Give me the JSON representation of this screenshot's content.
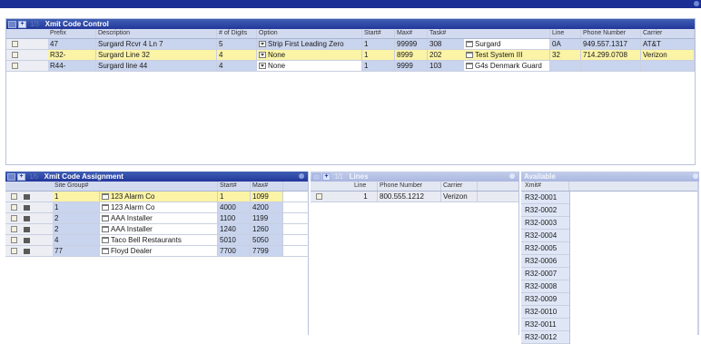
{
  "top_bar": {
    "color": "#1d2f95"
  },
  "xmit_code_control": {
    "title": "Xmit Code Control",
    "tb_labels": "1/3",
    "columns": [
      "Prefix",
      "Description",
      "# of Digits",
      "Option",
      "Start#",
      "Max#",
      "Task#",
      "Line",
      "Phone Number",
      "Carrier"
    ],
    "rows": [
      {
        "prefix": "47",
        "description": "Surgard Rcvr 4 Ln 7",
        "digits": "5",
        "option": "Strip First Leading Zero",
        "start": "1",
        "max": "99999",
        "task_num": "308",
        "task_name": "Surgard",
        "line": "0A",
        "phone": "949.557.1317",
        "carrier": "AT&T"
      },
      {
        "prefix": "R32-",
        "description": "Surgard Line 32",
        "digits": "4",
        "option": "None",
        "start": "1",
        "max": "8999",
        "task_num": "202",
        "task_name": "Test System III",
        "line": "32",
        "phone": "714.299.0708",
        "carrier": "Verizon"
      },
      {
        "prefix": "R44-",
        "description": "Surgard line 44",
        "digits": "4",
        "option": "None",
        "start": "1",
        "max": "9999",
        "task_num": "103",
        "task_name": "G4s Denmark Guard",
        "line": "",
        "phone": "",
        "carrier": ""
      }
    ]
  },
  "xmit_code_assignment": {
    "title": "Xmit Code Assignment",
    "tb_labels": "1/5",
    "columns": [
      "Site Group#",
      "Start#",
      "Max#"
    ],
    "rows": [
      {
        "group": "1",
        "name": "123 Alarm Co",
        "start": "1",
        "max": "1099"
      },
      {
        "group": "1",
        "name": "123 Alarm Co",
        "start": "4000",
        "max": "4200"
      },
      {
        "group": "2",
        "name": "AAA Installer",
        "start": "1100",
        "max": "1199"
      },
      {
        "group": "2",
        "name": "AAA Installer",
        "start": "1240",
        "max": "1260"
      },
      {
        "group": "4",
        "name": "Taco Bell Restaurants",
        "start": "5010",
        "max": "5050"
      },
      {
        "group": "77",
        "name": "Floyd Dealer",
        "start": "7700",
        "max": "7799"
      }
    ]
  },
  "lines": {
    "title": "Lines",
    "tb_labels": "1/1",
    "columns": [
      "Line",
      "Phone Number",
      "Carrier"
    ],
    "rows": [
      {
        "line": "1",
        "phone": "800.555.1212",
        "carrier": "Verizon"
      }
    ]
  },
  "available": {
    "title": "Available",
    "column": "Xmit#",
    "items": [
      "R32-0001",
      "R32-0002",
      "R32-0003",
      "R32-0004",
      "R32-0005",
      "R32-0006",
      "R32-0007",
      "R32-0008",
      "R32-0009",
      "R32-0010",
      "R32-0011",
      "R32-0012"
    ]
  }
}
